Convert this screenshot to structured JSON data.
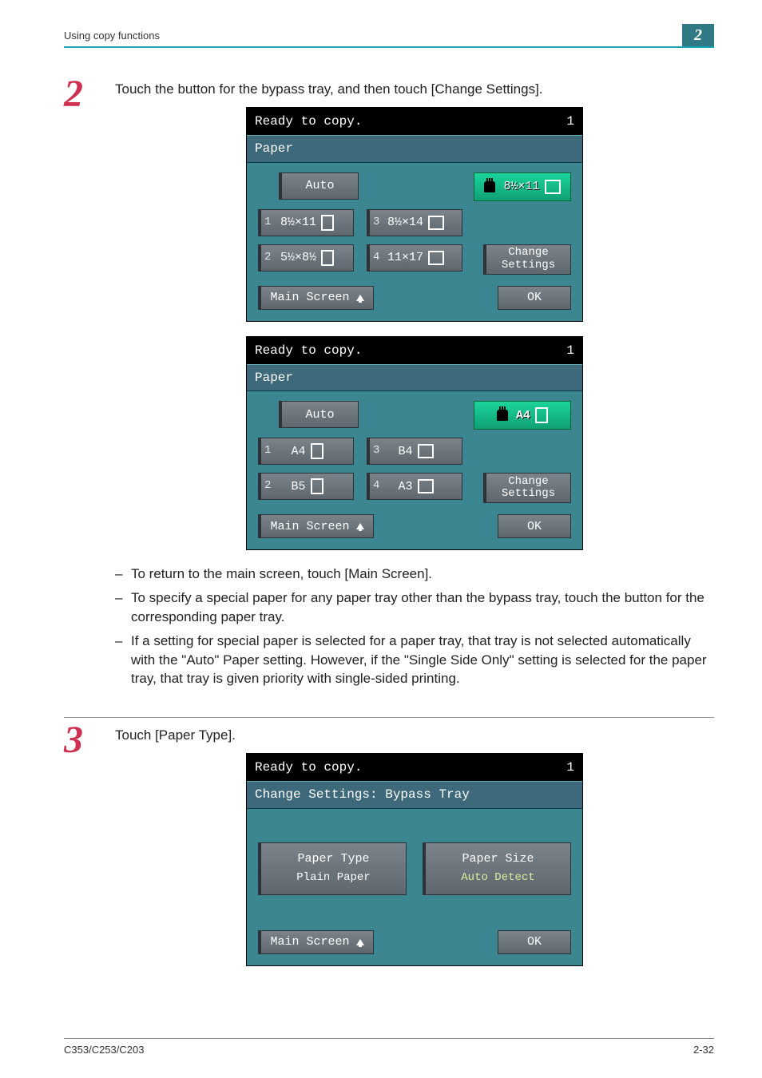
{
  "header": {
    "section_title": "Using copy functions",
    "chapter_number": "2"
  },
  "step2": {
    "number": "2",
    "text": "Touch the button for the bypass tray, and then touch [Change Settings].",
    "panelA": {
      "status": "Ready to copy.",
      "copies": "1",
      "title": "Paper",
      "auto": "Auto",
      "bypass": "8½×11",
      "tray1_num": "1",
      "tray1": "8½×11",
      "tray2_num": "2",
      "tray2": "5½×8½",
      "tray3_num": "3",
      "tray3": "8½×14",
      "tray4_num": "4",
      "tray4": "11×17",
      "change_settings": "Change Settings",
      "main_screen": "Main Screen",
      "ok": "OK"
    },
    "panelB": {
      "status": "Ready to copy.",
      "copies": "1",
      "title": "Paper",
      "auto": "Auto",
      "bypass": "A4",
      "tray1_num": "1",
      "tray1": "A4",
      "tray2_num": "2",
      "tray2": "B5",
      "tray3_num": "3",
      "tray3": "B4",
      "tray4_num": "4",
      "tray4": "A3",
      "change_settings": "Change Settings",
      "main_screen": "Main Screen",
      "ok": "OK"
    },
    "notes": [
      "To return to the main screen, touch [Main Screen].",
      "To specify a special paper for any paper tray other than the bypass tray, touch the button for the corresponding paper tray.",
      "If a setting for special paper is selected for a paper tray, that tray is not selected automatically with the \"Auto\" Paper setting. However, if the \"Single Side Only\" setting is selected for the paper tray, that tray is given priority with single-sided printing."
    ]
  },
  "step3": {
    "number": "3",
    "text": "Touch [Paper Type].",
    "panel": {
      "status": "Ready to copy.",
      "copies": "1",
      "title": "Change Settings: Bypass Tray",
      "paper_type_label": "Paper Type",
      "paper_type_value": "Plain Paper",
      "paper_size_label": "Paper Size",
      "paper_size_value": "Auto Detect",
      "main_screen": "Main Screen",
      "ok": "OK"
    }
  },
  "footer": {
    "model": "C353/C253/C203",
    "page": "2-32"
  }
}
